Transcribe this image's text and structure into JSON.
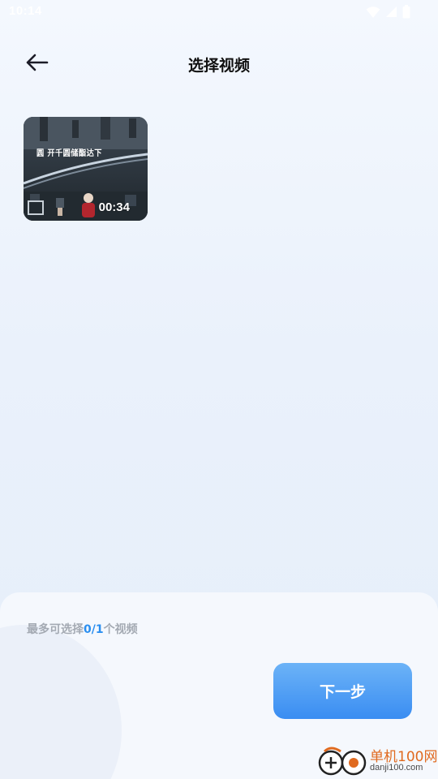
{
  "status_bar": {
    "time": "10:14",
    "icons": [
      "wifi-icon",
      "signal-icon",
      "battery-icon"
    ]
  },
  "header": {
    "title": "选择视频",
    "back_icon": "arrow-left-icon"
  },
  "videos": [
    {
      "caption": "圆 开千圆储酯达下",
      "duration": "00:34"
    }
  ],
  "footer": {
    "hint_prefix": "最多可选择",
    "selected": "0",
    "separator": "/",
    "max": "1",
    "hint_suffix": "个视频",
    "next_label": "下一步"
  },
  "watermark": {
    "name": "单机100网",
    "url": "danji100.com"
  },
  "colors": {
    "accent": "#2b8ff0",
    "button_top": "#6cb3f7",
    "button_bottom": "#3a8df2",
    "hint_text": "#a4aab3",
    "title_text": "#111111"
  }
}
